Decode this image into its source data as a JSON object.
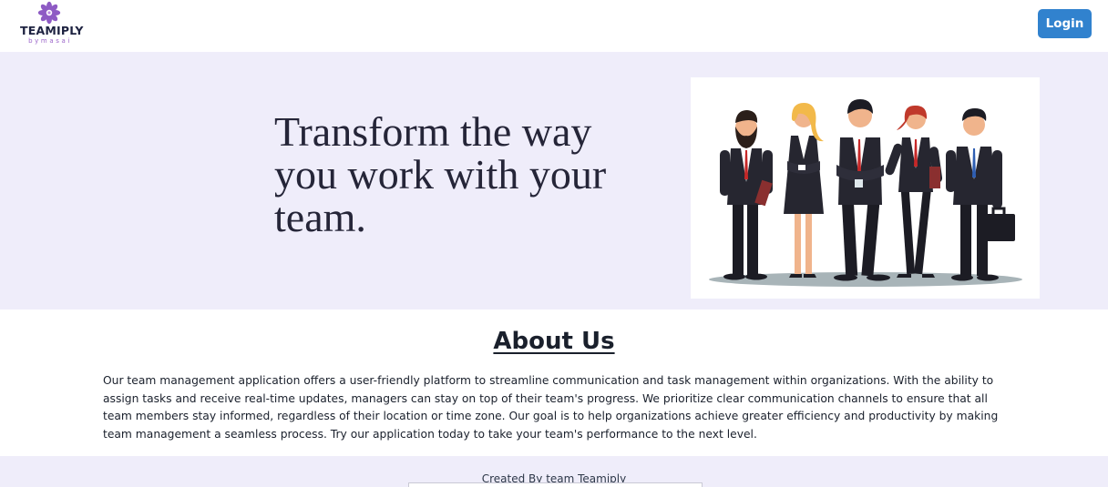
{
  "header": {
    "logo_text": "TEAMIPLY",
    "logo_subtext": "bymasai",
    "logo_icon": "flower-logo-icon",
    "login_label": "Login",
    "accent_color": "#3182ce",
    "brand_color": "#9a63c9"
  },
  "hero": {
    "title": "Transform the way you work with your team.",
    "image": "business-team-illustration",
    "background_color": "#efedfa"
  },
  "about": {
    "title": "About Us",
    "body": "Our team management application offers a user-friendly platform to streamline communication and task management within organizations. With the ability to assign tasks and receive real-time updates, managers can stay on top of their team's progress. We prioritize clear communication channels to ensure that all team members stay informed, regardless of their location or time zone. Our goal is to help organizations achieve greater efficiency and productivity by making team management a seamless process. Try our application today to take your team's performance to the next level."
  },
  "footer": {
    "text": "Created By team Teamiply"
  }
}
